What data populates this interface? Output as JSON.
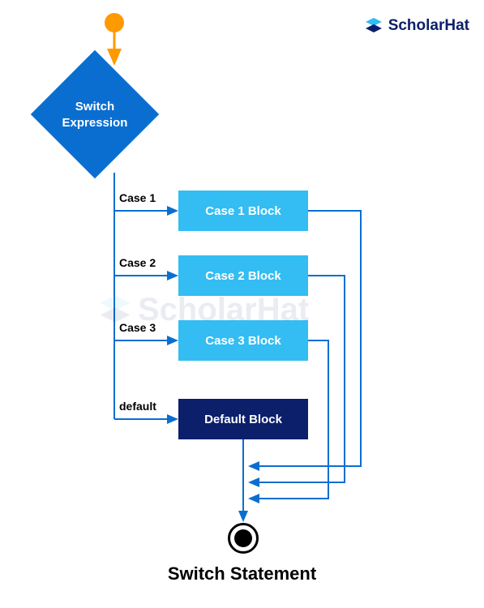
{
  "brand": {
    "name": "ScholarHat",
    "accent": "#33bdf2",
    "dark": "#0b1f6b"
  },
  "diagram": {
    "title": "Switch Statement",
    "decision": {
      "line1": "Switch",
      "line2": "Expression"
    },
    "cases": [
      {
        "label": "Case 1",
        "block": "Case 1 Block"
      },
      {
        "label": "Case 2",
        "block": "Case 2 Block"
      },
      {
        "label": "Case 3",
        "block": "Case 3 Block"
      }
    ],
    "default": {
      "label": "default",
      "block": "Default Block"
    }
  }
}
